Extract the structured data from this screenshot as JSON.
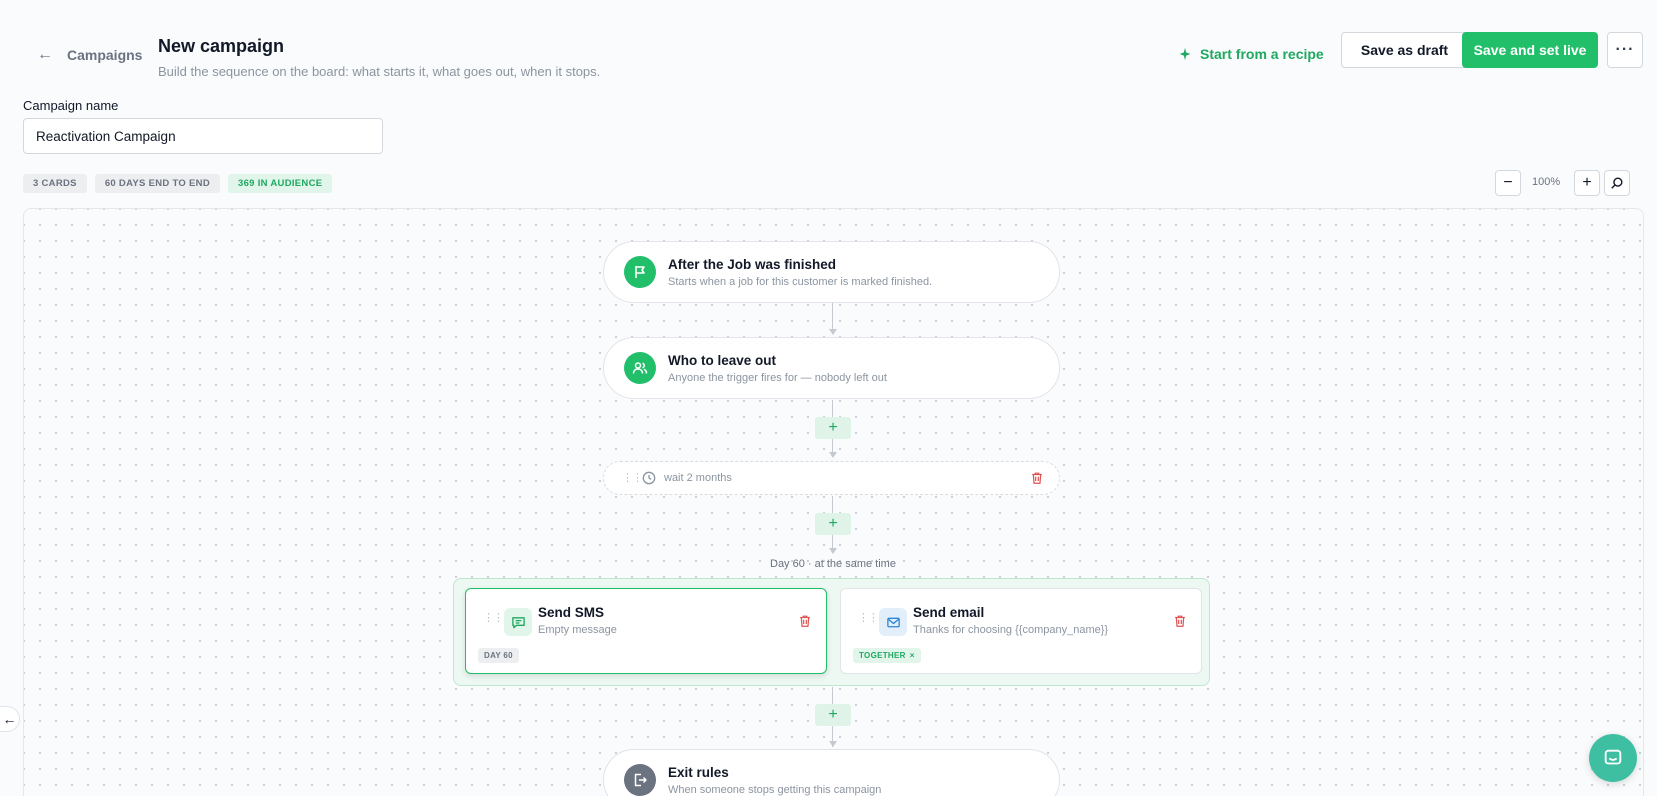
{
  "header": {
    "back_label": "Campaigns",
    "title": "New campaign",
    "subtitle": "Build the sequence on the board: what starts it, what goes out, when it stops.",
    "recipe_label": "Start from a recipe",
    "save_draft_label": "Save as draft",
    "save_live_label": "Save and set live",
    "more_label": "···"
  },
  "form": {
    "name_label": "Campaign name",
    "name_value": "Reactivation Campaign"
  },
  "stats": {
    "cards": "3 CARDS",
    "duration": "60 DAYS END TO END",
    "audience": "369 IN AUDIENCE"
  },
  "zoom": {
    "level": "100%",
    "minus": "−",
    "plus": "+"
  },
  "flow": {
    "trigger": {
      "title": "After the Job was finished",
      "subtitle": "Starts when a job for this customer is marked finished."
    },
    "exclusion": {
      "title": "Who to leave out",
      "subtitle": "Anyone the trigger fires for — nobody left out"
    },
    "wait": {
      "label": "wait 2 months"
    },
    "group_label": "Day 60 · at the same time",
    "cards": [
      {
        "title": "Send SMS",
        "subtitle": "Empty message",
        "tag": "DAY 60"
      },
      {
        "title": "Send email",
        "subtitle": "Thanks for choosing {{company_name}}",
        "tag": "TOGETHER"
      }
    ],
    "exit": {
      "title": "Exit rules",
      "subtitle": "When someone stops getting this campaign"
    },
    "add_symbol": "+"
  },
  "colors": {
    "accent": "#22bf6a",
    "accent_text": "#1fa860",
    "danger": "#e05252",
    "email_blue": "#2f86d6",
    "chat": "#3fbfa2"
  },
  "icons": {
    "back": "arrow-left-icon",
    "recipe": "sparkle-icon",
    "trigger": "flag-icon",
    "exclusion": "users-icon",
    "wait": "clock-icon",
    "sms": "message-icon",
    "email": "mail-icon",
    "exit": "exit-door-icon",
    "delete": "trash-icon",
    "zoom_fit": "zoom-search-icon",
    "chat": "chat-icon"
  }
}
